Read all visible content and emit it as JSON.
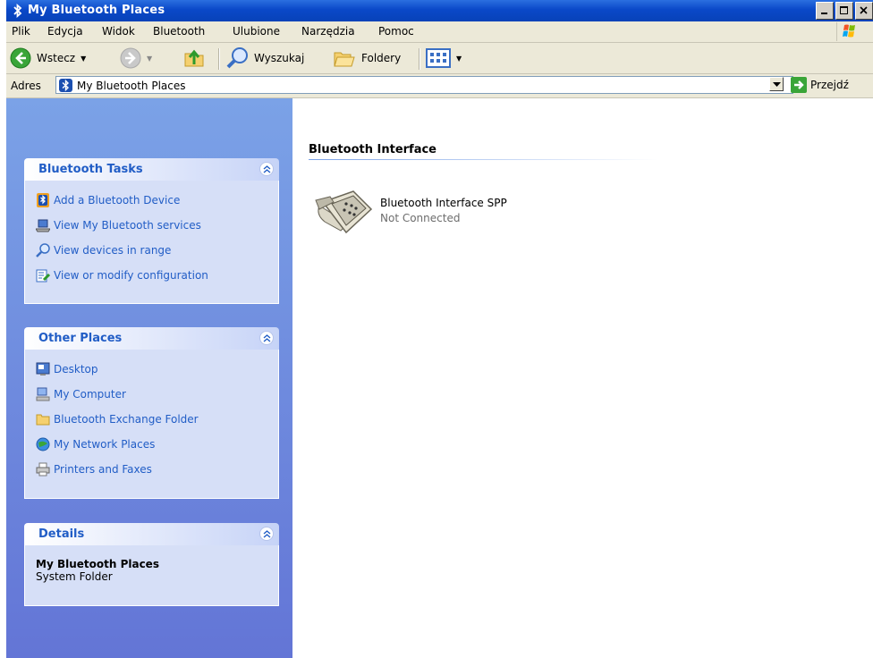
{
  "window": {
    "title": "My Bluetooth Places"
  },
  "menu": {
    "items": [
      {
        "label": "Plik"
      },
      {
        "label": "Edycja"
      },
      {
        "label": "Widok"
      },
      {
        "label": "Bluetooth"
      },
      {
        "label": "Ulubione"
      },
      {
        "label": "Narzędzia"
      },
      {
        "label": "Pomoc"
      }
    ]
  },
  "toolbar": {
    "back_label": "Wstecz",
    "search_label": "Wyszukaj",
    "folders_label": "Foldery"
  },
  "address": {
    "label": "Adres",
    "value": "My Bluetooth Places",
    "go_label": "Przejdź"
  },
  "tasks_panel": {
    "title": "Bluetooth Tasks",
    "items": [
      {
        "label": "Add a Bluetooth Device",
        "icon": "bluetooth-add-icon"
      },
      {
        "label": "View My Bluetooth services",
        "icon": "laptop-icon"
      },
      {
        "label": "View devices in range",
        "icon": "magnifier-icon"
      },
      {
        "label": "View or modify configuration",
        "icon": "config-icon"
      }
    ]
  },
  "other_places": {
    "title": "Other Places",
    "items": [
      {
        "label": "Desktop",
        "icon": "desktop-icon"
      },
      {
        "label": "My Computer",
        "icon": "my-computer-icon"
      },
      {
        "label": "Bluetooth Exchange Folder",
        "icon": "folder-icon"
      },
      {
        "label": "My Network Places",
        "icon": "network-icon"
      },
      {
        "label": "Printers and Faxes",
        "icon": "printer-icon"
      }
    ]
  },
  "details_panel": {
    "title": "Details",
    "name": "My Bluetooth Places",
    "type": "System Folder"
  },
  "content": {
    "group_title": "Bluetooth Interface",
    "devices": [
      {
        "name": "Bluetooth Interface SPP",
        "status": "Not Connected",
        "icon": "serial-port-icon"
      }
    ]
  },
  "colors": {
    "titlebar": "#0a48c8",
    "link": "#215dc6",
    "pane_gradient_top": "#7ba2e7",
    "pane_gradient_bottom": "#6375d6",
    "panel_body": "#d6dff7"
  }
}
